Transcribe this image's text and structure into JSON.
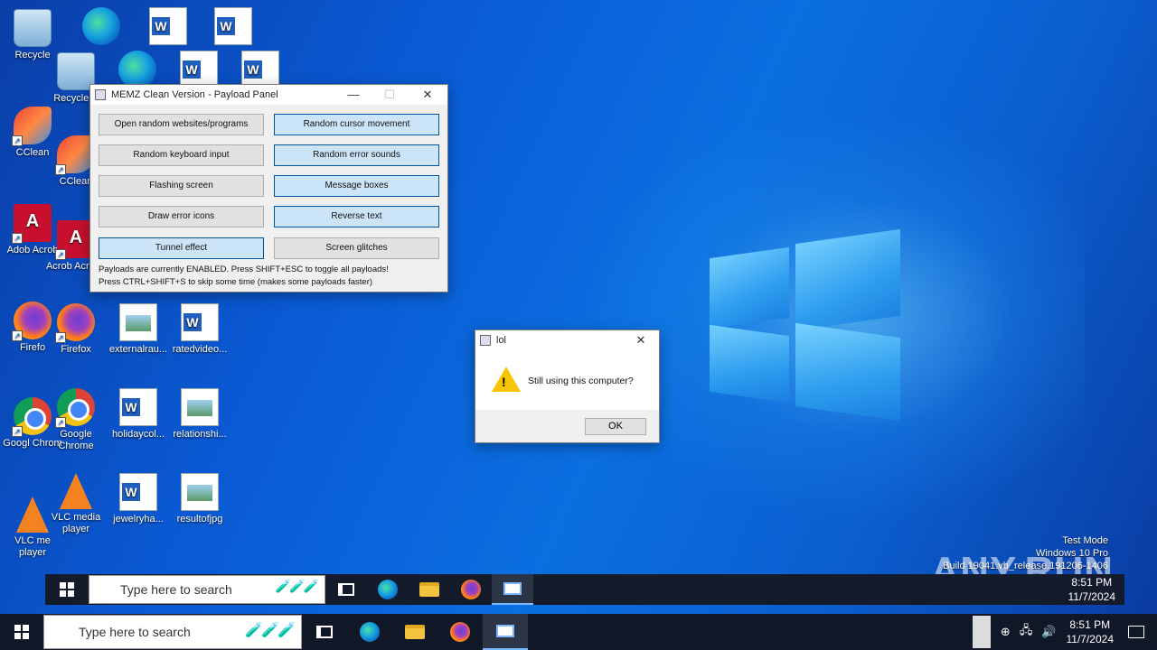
{
  "desktop": {
    "icons": [
      {
        "label": "Recycle",
        "kind": "bin"
      },
      {
        "label": "Recycle B",
        "kind": "bin"
      },
      {
        "label": "",
        "kind": "edge"
      },
      {
        "label": "",
        "kind": "edge"
      },
      {
        "label": "",
        "kind": "word"
      },
      {
        "label": "",
        "kind": "word"
      },
      {
        "label": "",
        "kind": "word"
      },
      {
        "label": "",
        "kind": "word"
      },
      {
        "label": "CClean",
        "kind": "ccleaner"
      },
      {
        "label": "CClean",
        "kind": "ccleaner"
      },
      {
        "label": "Adob Acrob",
        "kind": "acrobat"
      },
      {
        "label": "Acrob Acroba",
        "kind": "acrobat"
      },
      {
        "label": "Firefo",
        "kind": "firefox"
      },
      {
        "label": "Firefox",
        "kind": "firefox"
      },
      {
        "label": "externalrau...",
        "kind": "picture"
      },
      {
        "label": "ratedvideo...",
        "kind": "word"
      },
      {
        "label": "Googl Chrom",
        "kind": "chrome"
      },
      {
        "label": "Google Chrome",
        "kind": "chrome"
      },
      {
        "label": "holidaycol...",
        "kind": "word"
      },
      {
        "label": "relationshi...",
        "kind": "picture"
      },
      {
        "label": "VLC me player",
        "kind": "vlc"
      },
      {
        "label": "VLC media player",
        "kind": "vlc"
      },
      {
        "label": "jewelryha...",
        "kind": "word"
      },
      {
        "label": "resultofjpg",
        "kind": "picture"
      }
    ]
  },
  "payload_panel": {
    "title": "MEMZ Clean Version - Payload Panel",
    "buttons": [
      {
        "label": "Open random websites/programs",
        "enabled": false
      },
      {
        "label": "Random cursor movement",
        "enabled": true
      },
      {
        "label": "Random keyboard input",
        "enabled": false
      },
      {
        "label": "Random error sounds",
        "enabled": true
      },
      {
        "label": "Flashing screen",
        "enabled": false
      },
      {
        "label": "Message boxes",
        "enabled": true
      },
      {
        "label": "Draw error icons",
        "enabled": false
      },
      {
        "label": "Reverse text",
        "enabled": true
      },
      {
        "label": "Tunnel effect",
        "enabled": true
      },
      {
        "label": "Screen glitches",
        "enabled": false
      }
    ],
    "status_line1": "Payloads are currently ENABLED. Press SHIFT+ESC to toggle all payloads!",
    "status_line2": "Press CTRL+SHIFT+S to skip some time (makes some payloads faster)"
  },
  "message_box": {
    "title": "lol",
    "text": "Still using this computer?",
    "ok_label": "OK",
    "icon": "warning-icon"
  },
  "taskbar": {
    "search_placeholder": "Type here to search",
    "pinned": [
      "task-view",
      "edge",
      "file-explorer",
      "firefox",
      "memz"
    ],
    "time": "8:51 PM",
    "date": "11/7/2024"
  },
  "watermark": {
    "line1": "Test Mode",
    "line2": "Windows 10 Pro",
    "line3": "Build 19041.vb_release.191206-1406",
    "brand": "ANY.RUN"
  },
  "colors": {
    "taskbar": "#101828",
    "enabled_button": "#cce4f7",
    "disabled_button": "#e1e1e1",
    "warning": "#f6c400"
  }
}
